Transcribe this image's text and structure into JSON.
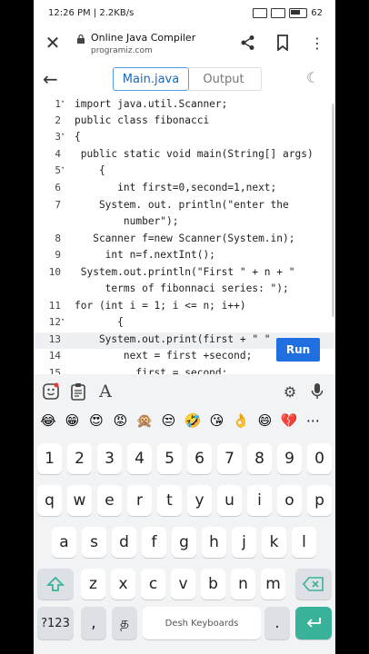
{
  "status": {
    "time": "12:26 PM",
    "speed": "2.2KB/s",
    "battery": "62"
  },
  "browser": {
    "title": "Online Java Compiler",
    "url": "programiz.com"
  },
  "tabs": {
    "main": "Main.java",
    "output": "Output"
  },
  "editor": {
    "lines": [
      {
        "n": "1",
        "fold": "▾",
        "text": "import java.util.Scanner;"
      },
      {
        "n": "2",
        "fold": "",
        "text": "public class fibonacci"
      },
      {
        "n": "3",
        "fold": "▾",
        "text": "{"
      },
      {
        "n": "4",
        "fold": "",
        "text": " public static void main(String[] args)"
      },
      {
        "n": "5",
        "fold": "▾",
        "text": "    {"
      },
      {
        "n": "6",
        "fold": "",
        "text": "       int first=0,second=1,next;"
      },
      {
        "n": "7",
        "fold": "",
        "text": "    System. out. println(\"enter the"
      },
      {
        "n": "",
        "fold": "",
        "text": "        number\");"
      },
      {
        "n": "8",
        "fold": "",
        "text": "   Scanner f=new Scanner(System.in);"
      },
      {
        "n": "9",
        "fold": "",
        "text": "     int n=f.nextInt();"
      },
      {
        "n": "10",
        "fold": "",
        "text": " System.out.println(\"First \" + n + \""
      },
      {
        "n": "",
        "fold": "",
        "text": "     terms of fibonnaci series: \");"
      },
      {
        "n": "11",
        "fold": "",
        "text": "for (int i = 1; i <= n; i++)"
      },
      {
        "n": "12",
        "fold": "▾",
        "text": "       {"
      },
      {
        "n": "13",
        "fold": "",
        "text": "    System.out.print(first + \" \""
      },
      {
        "n": "14",
        "fold": "",
        "text": "        next = first +second;"
      },
      {
        "n": "15",
        "fold": "",
        "text": "          first = second;"
      }
    ],
    "run_label": "Run"
  },
  "keyboard": {
    "emojis": [
      "😂",
      "😁",
      "😍",
      "😡",
      "🙊",
      "😒",
      "🤣",
      "😘",
      "👌",
      "😄",
      "💔",
      "⋯"
    ],
    "rows": [
      [
        "1",
        "2",
        "3",
        "4",
        "5",
        "6",
        "7",
        "8",
        "9",
        "0"
      ],
      [
        "q",
        "w",
        "e",
        "r",
        "t",
        "y",
        "u",
        "i",
        "o",
        "p"
      ],
      [
        "a",
        "s",
        "d",
        "f",
        "g",
        "h",
        "j",
        "k",
        "l"
      ],
      [
        "z",
        "x",
        "c",
        "v",
        "b",
        "n",
        "m"
      ]
    ],
    "symbols_key": "?123",
    "comma_key": ",",
    "lang_key": "த",
    "space_label": "Desh Keyboards",
    "period_key": "."
  }
}
